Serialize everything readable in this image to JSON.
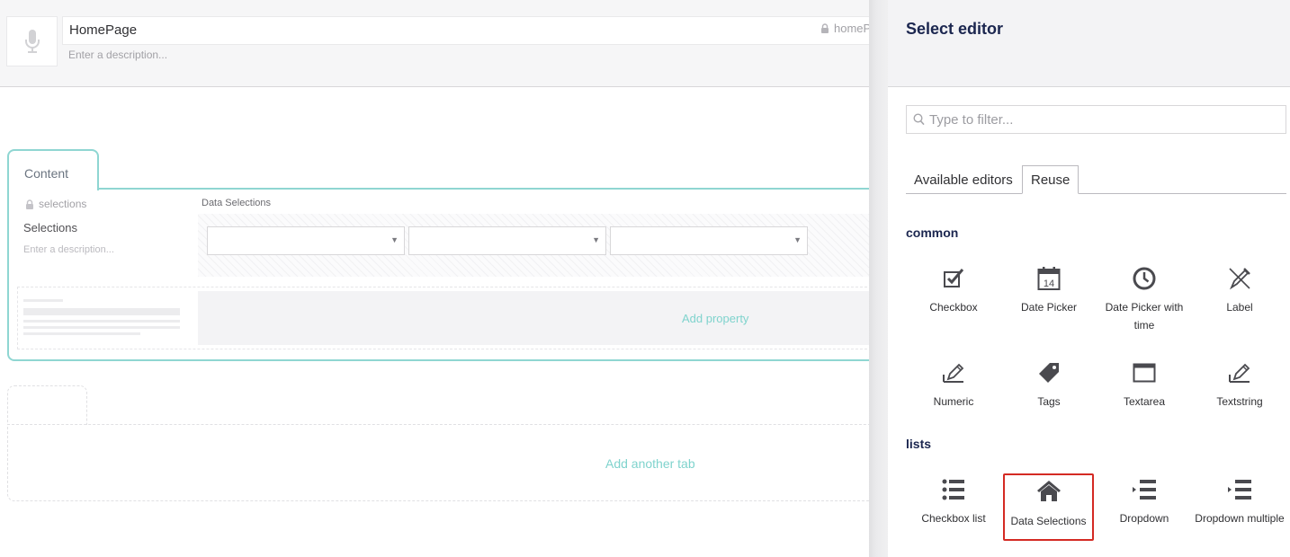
{
  "header": {
    "name": "HomePage",
    "alias": "homeP",
    "description_placeholder": "Enter a description..."
  },
  "group": {
    "tab_label": "Content",
    "property": {
      "alias": "selections",
      "name": "Selections",
      "description_placeholder": "Enter a description...",
      "editor_name": "Data Selections",
      "dropdowns": [
        "",
        "",
        ""
      ]
    },
    "add_property_label": "Add property"
  },
  "add_tab_label": "Add another tab",
  "panel": {
    "title": "Select editor",
    "filter_placeholder": "Type to filter...",
    "tabs": [
      {
        "label": "Available editors",
        "active": false
      },
      {
        "label": "Reuse",
        "active": true
      }
    ],
    "groups": [
      {
        "title": "common",
        "items": [
          {
            "label": "Checkbox",
            "icon": "checkbox-icon"
          },
          {
            "label": "Date Picker",
            "icon": "calendar-icon"
          },
          {
            "label": "Date Picker with time",
            "icon": "clock-icon"
          },
          {
            "label": "Label",
            "icon": "label-pen-icon"
          },
          {
            "label": "Numeric",
            "icon": "edit-icon"
          },
          {
            "label": "Tags",
            "icon": "tags-icon"
          },
          {
            "label": "Textarea",
            "icon": "window-icon"
          },
          {
            "label": "Textstring",
            "icon": "edit-icon"
          }
        ]
      },
      {
        "title": "lists",
        "items": [
          {
            "label": "Checkbox list",
            "icon": "bulleted-list-icon"
          },
          {
            "label": "Data Selections",
            "icon": "home-icon",
            "selected": true
          },
          {
            "label": "Dropdown",
            "icon": "indent-list-icon"
          },
          {
            "label": "Dropdown multiple",
            "icon": "indent-list-icon"
          }
        ]
      }
    ]
  }
}
